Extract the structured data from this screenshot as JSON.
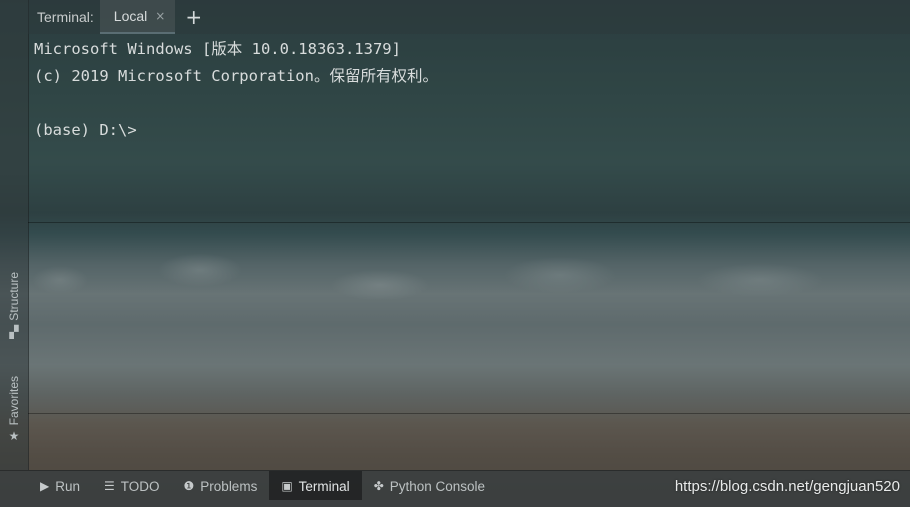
{
  "tabbar": {
    "title": "Terminal:",
    "tab_label": "Local",
    "close_glyph": "×",
    "add_glyph": "+"
  },
  "terminal": {
    "lines": [
      "Microsoft Windows [版本 10.0.18363.1379]",
      "(c) 2019 Microsoft Corporation。保留所有权利。",
      "",
      "(base) D:\\>"
    ]
  },
  "left_strip": {
    "structure_label": "Structure",
    "favorites_label": "Favorites"
  },
  "bottombar": {
    "items": [
      {
        "label": "Run",
        "icon": "play-icon"
      },
      {
        "label": "TODO",
        "icon": "list-icon"
      },
      {
        "label": "Problems",
        "icon": "info-icon"
      },
      {
        "label": "Terminal",
        "icon": "terminal-icon",
        "active": true
      },
      {
        "label": "Python Console",
        "icon": "python-icon"
      }
    ]
  },
  "watermark": "https://blog.csdn.net/gengjuan520",
  "colors": {
    "text": "#d8dcdc",
    "active_tab": "#1c1e1f"
  }
}
